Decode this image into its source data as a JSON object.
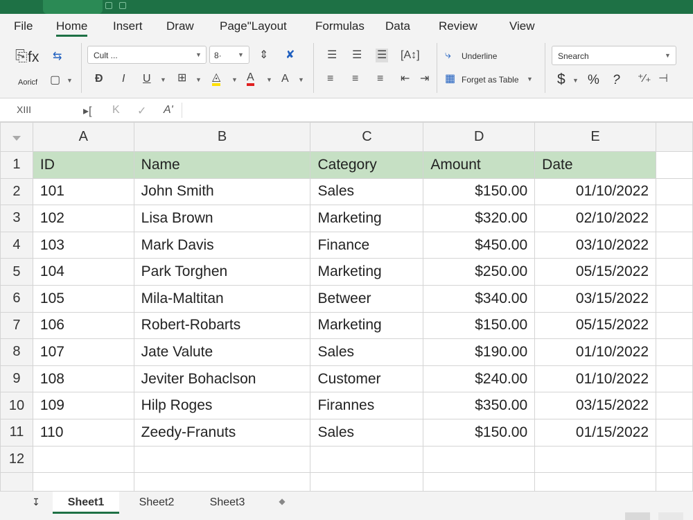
{
  "menu": {
    "items": [
      "File",
      "Home",
      "Insert",
      "Draw",
      "Page\"Layout",
      "Formulas",
      "Data",
      "Review",
      "View"
    ]
  },
  "ribbon": {
    "fx_label": "fx",
    "autofit_label": "Aoricf",
    "font_name": "Cult ...",
    "font_size": "8·",
    "italic": "I",
    "underline_u": "U",
    "font_color_a": "A",
    "text_size_a": "A",
    "underline_label": "Underline",
    "format_table_label": "Forget as Table",
    "number_format": "Snearch",
    "currency": "$",
    "percent": "%",
    "question": "?"
  },
  "formula_bar": {
    "name_box": "XIII",
    "fx_symbol": "A'"
  },
  "grid": {
    "columns": [
      "A",
      "B",
      "C",
      "D",
      "E"
    ],
    "header": [
      "ID",
      "Name",
      "Category",
      "Amount",
      "Date"
    ],
    "rows": [
      [
        "101",
        "John Smith",
        "Sales",
        "$150.00",
        "01/10/2022"
      ],
      [
        "102",
        "Lisa Brown",
        "Marketing",
        "$320.00",
        "02/10/2022"
      ],
      [
        "103",
        "Mark Davis",
        "Finance",
        "$450.00",
        "03/10/2022"
      ],
      [
        "104",
        "Park Torghen",
        "Marketing",
        "$250.00",
        "05/15/2022"
      ],
      [
        "105",
        "Mila-Maltitan",
        "Betweer",
        "$340.00",
        "03/15/2022"
      ],
      [
        "106",
        "Robert-Robarts",
        "Marketing",
        "$150.00",
        "05/15/2022"
      ],
      [
        "107",
        "Jate Valute",
        "Sales",
        "$190.00",
        "01/10/2022"
      ],
      [
        "108",
        "Jeviter Bohaclson",
        "Customer",
        "$240.00",
        "01/10/2022"
      ],
      [
        "109",
        "Hilp Roges",
        "Firannes",
        "$350.00",
        "03/15/2022"
      ],
      [
        "110",
        "Zeedy-Franuts",
        "Sales",
        "$150.00",
        "01/15/2022"
      ]
    ],
    "row_numbers": [
      "1",
      "2",
      "3",
      "4",
      "5",
      "6",
      "7",
      "8",
      "9",
      "10",
      "11",
      "12"
    ],
    "header_fill": "#c6e0c4"
  },
  "sheets": {
    "tabs": [
      "Sheet1",
      "Sheet2",
      "Sheet3"
    ],
    "active": "Sheet1",
    "nav_symbol": "↧",
    "add_symbol": "◆"
  },
  "colors": {
    "brand": "#1e7145",
    "highlight_yellow": "#ffe000",
    "font_red": "#e02020"
  }
}
